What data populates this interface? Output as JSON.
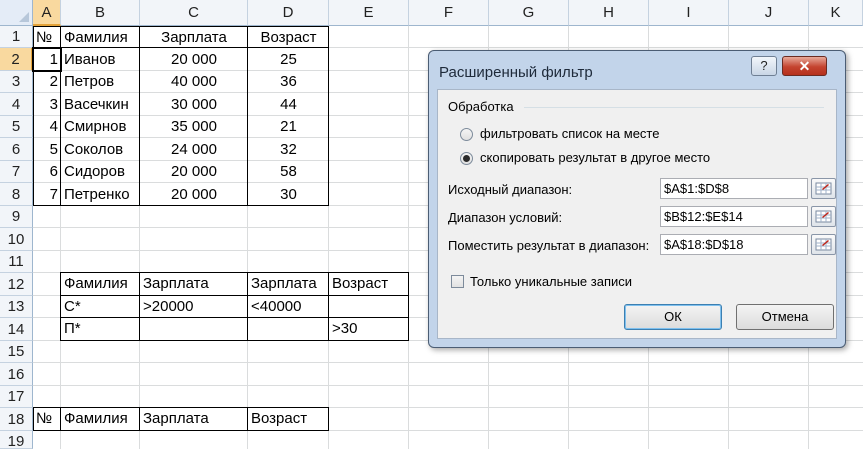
{
  "columns": [
    "A",
    "B",
    "C",
    "D",
    "E",
    "F",
    "G",
    "H",
    "I",
    "J",
    "K"
  ],
  "rows": [
    "1",
    "2",
    "3",
    "4",
    "5",
    "6",
    "7",
    "8",
    "9",
    "10",
    "11",
    "12",
    "13",
    "14",
    "15",
    "16",
    "17",
    "18",
    "19"
  ],
  "table1": {
    "headers": [
      "№",
      "Фамилия",
      "Зарплата",
      "Возраст"
    ],
    "rows": [
      [
        "1",
        "Иванов",
        "20 000",
        "25"
      ],
      [
        "2",
        "Петров",
        "40 000",
        "36"
      ],
      [
        "3",
        "Васечкин",
        "30 000",
        "44"
      ],
      [
        "4",
        "Смирнов",
        "35 000",
        "21"
      ],
      [
        "5",
        "Соколов",
        "24 000",
        "32"
      ],
      [
        "6",
        "Сидоров",
        "20 000",
        "58"
      ],
      [
        "7",
        "Петренко",
        "20 000",
        "30"
      ]
    ]
  },
  "criteria": {
    "headers": [
      "Фамилия",
      "Зарплата",
      "Зарплата",
      "Возраст"
    ],
    "rows": [
      [
        "С*",
        ">20000",
        "<40000",
        ""
      ],
      [
        "П*",
        "",
        "",
        ">30"
      ]
    ]
  },
  "output_headers": [
    "№",
    "Фамилия",
    "Зарплата",
    "Возраст"
  ],
  "dialog": {
    "title": "Расширенный фильтр",
    "help_label": "?",
    "close_label": "✕",
    "group_label": "Обработка",
    "radio_filter_in_place": "фильтровать список на месте",
    "radio_copy": "скопировать результат в другое место",
    "source_range_label": "Исходный диапазон:",
    "source_range_value": "$A$1:$D$8",
    "criteria_range_label": "Диапазон условий:",
    "criteria_range_value": "$B$12:$E$14",
    "output_range_label": "Поместить результат в диапазон:",
    "output_range_value": "$A$18:$D$18",
    "unique_label": "Только уникальные записи",
    "ok_label": "ОК",
    "cancel_label": "Отмена"
  }
}
